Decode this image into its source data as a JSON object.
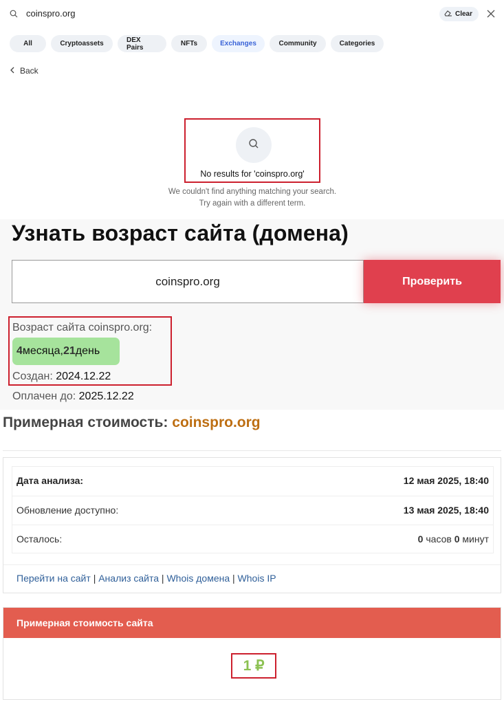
{
  "search": {
    "query": "coinspro.org",
    "clear_label": "Clear"
  },
  "tabs": [
    {
      "label": "All"
    },
    {
      "label": "Cryptoassets"
    },
    {
      "label": "DEX Pairs"
    },
    {
      "label": "NFTs"
    },
    {
      "label": "Exchanges"
    },
    {
      "label": "Community"
    },
    {
      "label": "Categories"
    }
  ],
  "active_tab": "Exchanges",
  "back_label": "Back",
  "empty_state": {
    "title": "No results for 'coinspro.org'",
    "line1": "We couldn't find anything matching your search.",
    "line2": "Try again with a different term."
  },
  "age": {
    "heading": "Узнать возраст сайта (домена)",
    "input_value": "coinspro.org",
    "button_label": "Проверить",
    "age_label": "Возраст сайта coinspro.org:",
    "months_num": "4",
    "months_word": " месяца, ",
    "days_num": "21",
    "days_word": " день",
    "created_label": "Создан: ",
    "created_value": "2024.12.22",
    "paid_label": "Оплачен до: ",
    "paid_value": "2025.12.22"
  },
  "cost": {
    "title_prefix": "Примерная стоимость: ",
    "title_domain": "coinspro.org",
    "rows": [
      {
        "key": "Дата анализа:",
        "value": "12 мая 2025, 18:40"
      },
      {
        "key": "Обновление доступно:",
        "value": "13 мая 2025, 18:40"
      },
      {
        "key": "Осталось:",
        "hours_num": "0",
        "hours_word": " часов ",
        "minutes_num": "0",
        "minutes_word": " минут"
      }
    ],
    "links": [
      "Перейти на сайт",
      "Анализ сайта",
      "Whois домена",
      "Whois IP"
    ],
    "price_header": "Примерная стоимость сайта",
    "price_value": "1 ₽"
  },
  "colors": {
    "accent_red": "#e0404e",
    "highlight_border": "#cc1f2d",
    "age_badge_green": "#a6e39c",
    "domain_orange": "#bd6e12",
    "price_header": "#e35d4f",
    "price_green": "#8cc152",
    "active_tab_blue": "#3a63d7"
  }
}
